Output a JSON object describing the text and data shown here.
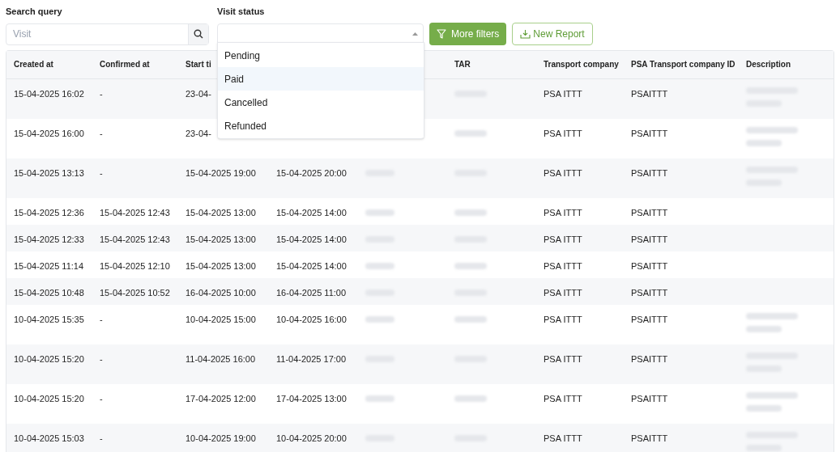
{
  "search": {
    "label": "Search query",
    "placeholder": "Visit"
  },
  "visit_status": {
    "label": "Visit status",
    "expanded": true,
    "options": [
      {
        "label": "Pending",
        "selected": false
      },
      {
        "label": "Paid",
        "selected": true
      },
      {
        "label": "Cancelled",
        "selected": false
      },
      {
        "label": "Refunded",
        "selected": false
      }
    ]
  },
  "buttons": [
    {
      "kind": "filled",
      "label": "More filters"
    },
    {
      "kind": "outline",
      "label": "New Report"
    }
  ],
  "table": {
    "columns": [
      "Created at",
      "Confirmed at",
      "Start ti",
      "",
      "",
      "TAR",
      "Transport company",
      "PSA Transport company ID",
      "Description"
    ],
    "rows": [
      {
        "created_at": "15-04-2025 16:02",
        "confirmed_at": "-",
        "start_time": "23-04-",
        "end_time": "",
        "transport_company": "PSA ITTT",
        "psa_id": "PSAITTT",
        "has_description": true
      },
      {
        "created_at": "15-04-2025 16:00",
        "confirmed_at": "-",
        "start_time": "23-04-",
        "end_time": "",
        "transport_company": "PSA ITTT",
        "psa_id": "PSAITTT",
        "has_description": true
      },
      {
        "created_at": "15-04-2025 13:13",
        "confirmed_at": "-",
        "start_time": "15-04-2025 19:00",
        "end_time": "15-04-2025 20:00",
        "transport_company": "PSA ITTT",
        "psa_id": "PSAITTT",
        "has_description": true
      },
      {
        "created_at": "15-04-2025 12:36",
        "confirmed_at": "15-04-2025 12:43",
        "start_time": "15-04-2025 13:00",
        "end_time": "15-04-2025 14:00",
        "transport_company": "PSA ITTT",
        "psa_id": "PSAITTT",
        "has_description": false
      },
      {
        "created_at": "15-04-2025 12:33",
        "confirmed_at": "15-04-2025 12:43",
        "start_time": "15-04-2025 13:00",
        "end_time": "15-04-2025 14:00",
        "transport_company": "PSA ITTT",
        "psa_id": "PSAITTT",
        "has_description": false
      },
      {
        "created_at": "15-04-2025 11:14",
        "confirmed_at": "15-04-2025 12:10",
        "start_time": "15-04-2025 13:00",
        "end_time": "15-04-2025 14:00",
        "transport_company": "PSA ITTT",
        "psa_id": "PSAITTT",
        "has_description": false
      },
      {
        "created_at": "15-04-2025 10:48",
        "confirmed_at": "15-04-2025 10:52",
        "start_time": "16-04-2025 10:00",
        "end_time": "16-04-2025 11:00",
        "transport_company": "PSA ITTT",
        "psa_id": "PSAITTT",
        "has_description": false
      },
      {
        "created_at": "10-04-2025 15:35",
        "confirmed_at": "-",
        "start_time": "10-04-2025 15:00",
        "end_time": "10-04-2025 16:00",
        "transport_company": "PSA ITTT",
        "psa_id": "PSAITTT",
        "has_description": true
      },
      {
        "created_at": "10-04-2025 15:20",
        "confirmed_at": "-",
        "start_time": "11-04-2025 16:00",
        "end_time": "11-04-2025 17:00",
        "transport_company": "PSA ITTT",
        "psa_id": "PSAITTT",
        "has_description": true
      },
      {
        "created_at": "10-04-2025 15:20",
        "confirmed_at": "-",
        "start_time": "17-04-2025 12:00",
        "end_time": "17-04-2025 13:00",
        "transport_company": "PSA ITTT",
        "psa_id": "PSAITTT",
        "has_description": true
      },
      {
        "created_at": "10-04-2025 15:03",
        "confirmed_at": "-",
        "start_time": "10-04-2025 19:00",
        "end_time": "10-04-2025 20:00",
        "transport_company": "PSA ITTT",
        "psa_id": "PSAITTT",
        "has_description": true
      }
    ]
  }
}
